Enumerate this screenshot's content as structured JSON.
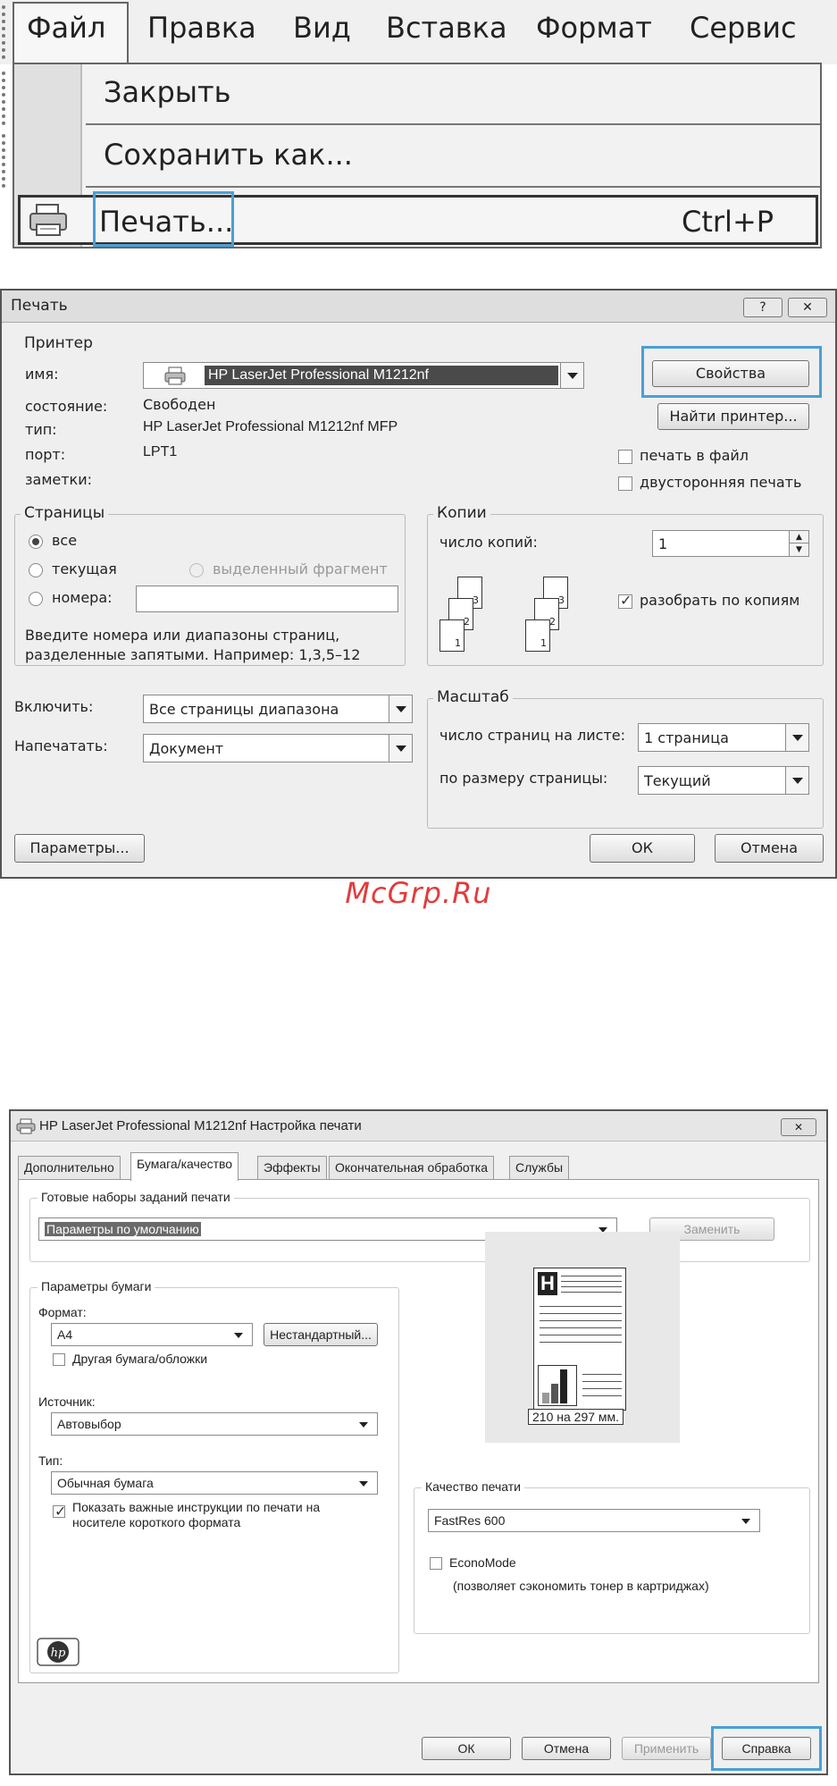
{
  "menu": {
    "bar": {
      "items": [
        {
          "label": "Файл",
          "mnemonic": "Ф"
        },
        {
          "label": "Правка",
          "mnemonic": "П"
        },
        {
          "label": "Вид",
          "mnemonic": "В"
        },
        {
          "label": "Вставка",
          "mnemonic": "а"
        },
        {
          "label": "Формат",
          "mnemonic": "м"
        },
        {
          "label": "Сервис",
          "mnemonic": "е"
        }
      ]
    },
    "dropdown": {
      "close": "Закрыть",
      "save_as": "Сохранить как...",
      "print": "Печать...",
      "print_shortcut": "Ctrl+P"
    }
  },
  "print_dialog": {
    "title": "Печать",
    "help_btn": "?",
    "close_btn": "✕",
    "printer": {
      "group": "Принтер",
      "name_label": "имя:",
      "name_value": "HP LaserJet Professional M1212nf",
      "status_label": "состояние:",
      "status_value": "Свободен",
      "type_label": "тип:",
      "type_value": "HP LaserJet Professional M1212nf MFP",
      "port_label": "порт:",
      "port_value": "LPT1",
      "notes_label": "заметки:",
      "properties_btn": "Свойства",
      "find_printer_btn": "Найти принтер...",
      "print_to_file": "печать в файл",
      "duplex": "двусторонняя печать"
    },
    "pages": {
      "group": "Страницы",
      "all": "все",
      "current": "текущая",
      "selection": "выделенный фрагмент",
      "numbers": "номера:",
      "hint_line1": "Введите номера или диапазоны страниц,",
      "hint_line2": "разделенные запятыми. Например: 1,3,5–12"
    },
    "copies": {
      "group": "Копии",
      "count_label": "число копий:",
      "count_value": "1",
      "collate": "разобрать по копиям",
      "page_nums": [
        "1",
        "2",
        "3"
      ]
    },
    "include_label": "Включить:",
    "include_value": "Все страницы диапазона",
    "print_what_label": "Напечатать:",
    "print_what_value": "Документ",
    "scale": {
      "group": "Масштаб",
      "pages_per_sheet_label": "число страниц на листе:",
      "pages_per_sheet_value": "1 страница",
      "fit_label": "по размеру страницы:",
      "fit_value": "Текущий"
    },
    "options_btn": "Параметры...",
    "ok_btn": "ОК",
    "cancel_btn": "Отмена"
  },
  "watermark": "McGrp.Ru",
  "hp_dialog": {
    "title": "HP LaserJet Professional M1212nf Настройка печати",
    "close_btn": "✕",
    "tabs": [
      "Дополнительно",
      "Бумага/качество",
      "Эффекты",
      "Окончательная обработка",
      "Службы"
    ],
    "presets": {
      "group": "Готовые наборы заданий печати",
      "value": "Параметры по умолчанию",
      "replace_btn": "Заменить"
    },
    "paper": {
      "group": "Параметры бумаги",
      "format_label": "Формат:",
      "format_value": "A4",
      "custom_btn": "Нестандартный...",
      "other_paper": "Другая бумага/обложки",
      "source_label": "Источник:",
      "source_value": "Автовыбор",
      "type_label": "Тип:",
      "type_value": "Обычная бумага",
      "instructions_line1": "Показать важные инструкции по печати на",
      "instructions_line2": "носителе короткого формата"
    },
    "preview": {
      "letter": "H",
      "size": "210 на 297 мм."
    },
    "quality": {
      "group": "Качество печати",
      "value": "FastRes 600",
      "economode": "EconoMode",
      "economode_hint": "(позволяет сэкономить тонер в картриджах)"
    },
    "ok_btn": "ОК",
    "cancel_btn": "Отмена",
    "apply_btn": "Применить",
    "help_btn": "Справка"
  }
}
